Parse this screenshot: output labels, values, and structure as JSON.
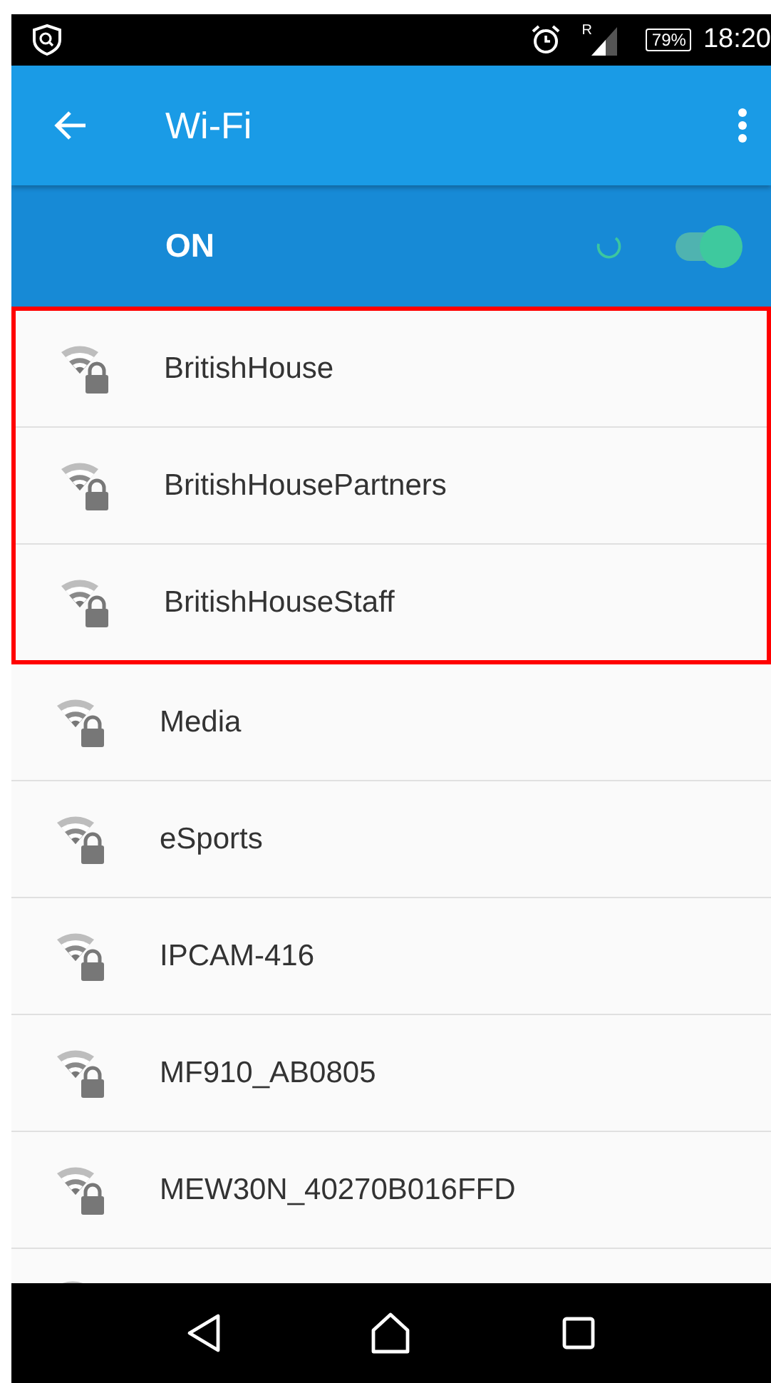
{
  "status_bar": {
    "roaming": "R",
    "battery": "79%",
    "time": "18:20"
  },
  "app_bar": {
    "title": "Wi-Fi"
  },
  "wifi_switch": {
    "label": "ON",
    "on": true
  },
  "highlighted_networks": [
    {
      "name": "BritishHouse"
    },
    {
      "name": "BritishHousePartners"
    },
    {
      "name": "BritishHouseStaff"
    }
  ],
  "networks": [
    {
      "name": "Media"
    },
    {
      "name": "eSports"
    },
    {
      "name": "IPCAM-416"
    },
    {
      "name": "MF910_AB0805"
    },
    {
      "name": "MEW30N_40270B016FFD"
    }
  ]
}
